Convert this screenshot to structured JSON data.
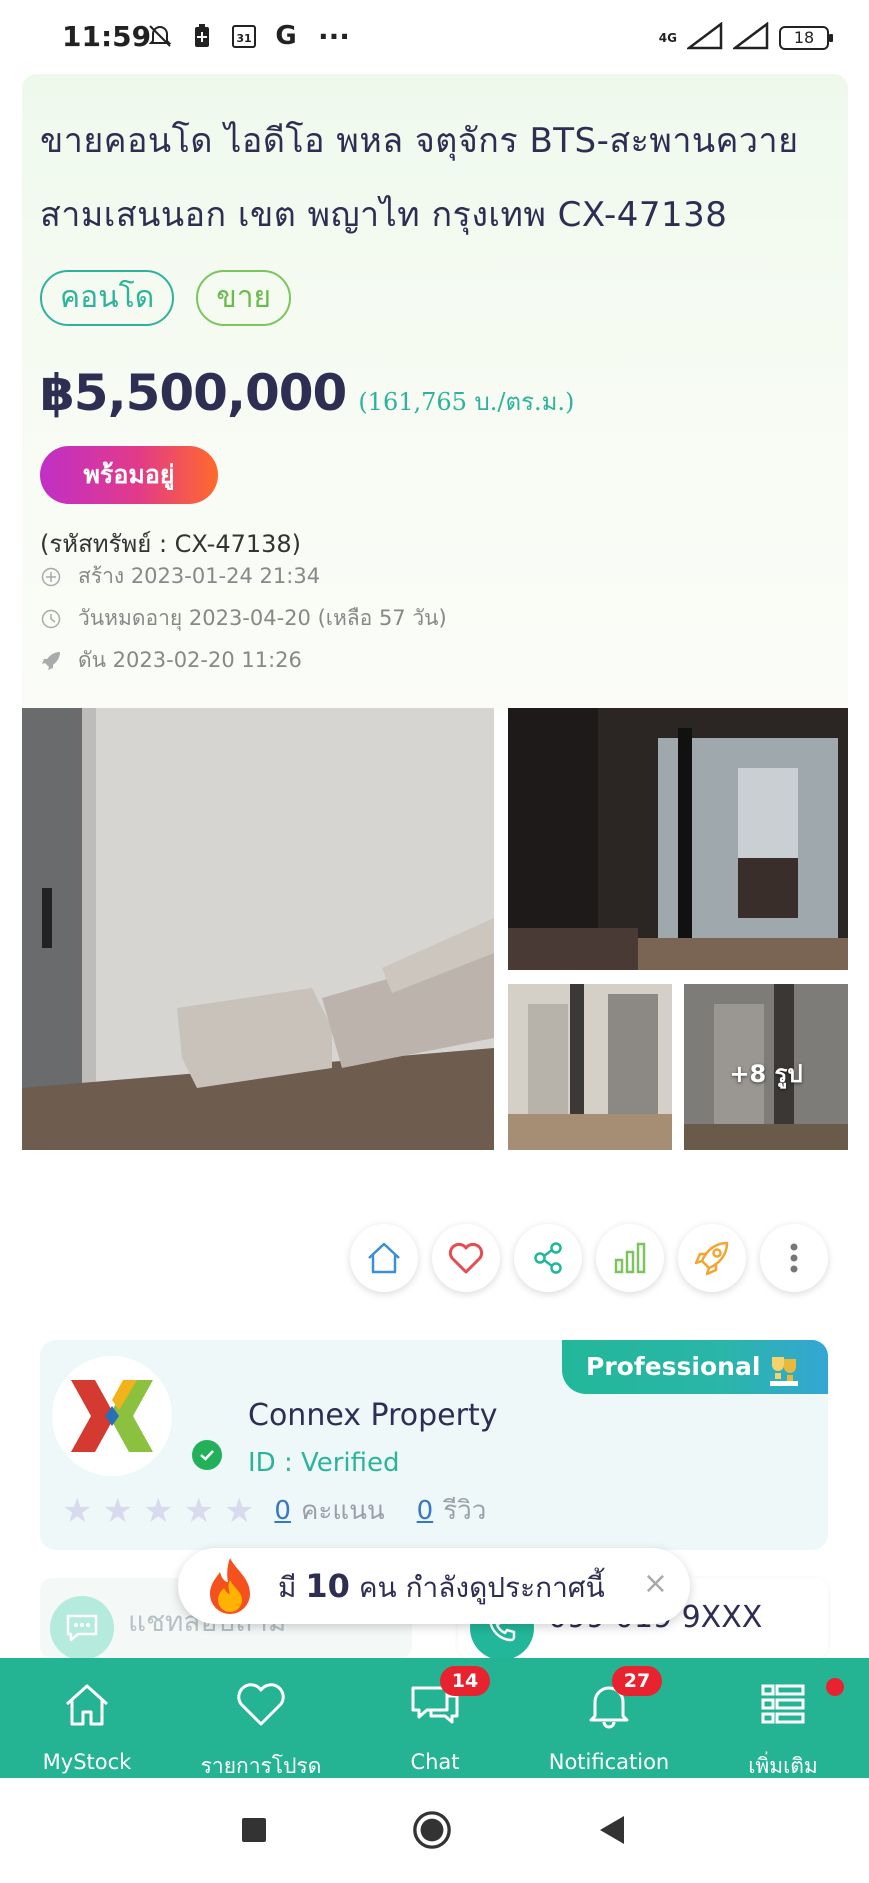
{
  "status_bar": {
    "time": "11:59",
    "network": "4G",
    "battery": "18",
    "icons": [
      "mute-icon",
      "battery-saver-icon",
      "calendar-icon",
      "google-icon",
      "more-dots-icon",
      "signal-icon",
      "signal-icon",
      "battery-icon"
    ],
    "calendar_day": "31",
    "google_letter": "G",
    "more": "···"
  },
  "listing": {
    "title": "ขายคอนโด ไอดีโอ พหล จตุจักร BTS-สะพานควาย สามเสนนอก เขต พญาไท กรุงเทพ CX-47138",
    "tags": [
      "คอนโด",
      "ขาย"
    ],
    "price": "฿5,500,000",
    "price_per_sqm": "(161,765 บ./ตร.ม.)",
    "status_badge": "พร้อมอยู่",
    "property_code": "(รหัสทรัพย์ : CX-47138)",
    "created": "สร้าง 2023-01-24 21:34",
    "expires": "วันหมดอายุ 2023-04-20  (เหลือ 57 วัน)",
    "bumped": "ดัน 2023-02-20 11:26"
  },
  "gallery": {
    "more_photos": "+8 รูป"
  },
  "actions": [
    "home-icon",
    "heart-icon",
    "share-icon",
    "chart-icon",
    "rocket-icon",
    "more-vertical-icon"
  ],
  "agent": {
    "badge": "Professional",
    "name": "Connex Property",
    "id_status": "ID : Verified",
    "rating_stars": 0,
    "score_count": "0",
    "score_label": "คะแนน",
    "review_count": "0",
    "review_label": "รีวิว"
  },
  "contact": {
    "chat_label": "แชทสอบถาม",
    "phone": "099 019 9XXX"
  },
  "toast": {
    "prefix": "มี",
    "count": "10",
    "suffix": "คน กำลังดูประกาศนี้",
    "close": "×"
  },
  "bottom_nav": {
    "items": [
      {
        "label": "MyStock",
        "icon": "home-icon"
      },
      {
        "label": "รายการโปรด",
        "icon": "heart-icon"
      },
      {
        "label": "Chat",
        "icon": "chat-icon",
        "badge": "14"
      },
      {
        "label": "Notification",
        "icon": "bell-icon",
        "badge": "27"
      },
      {
        "label": "เพิ่มเติม",
        "icon": "menu-list-icon"
      }
    ]
  },
  "colors": {
    "primary": "#24b393",
    "accent_teal": "#2db39b",
    "badge_red": "#e8222e",
    "title_navy": "#2e2e52"
  }
}
